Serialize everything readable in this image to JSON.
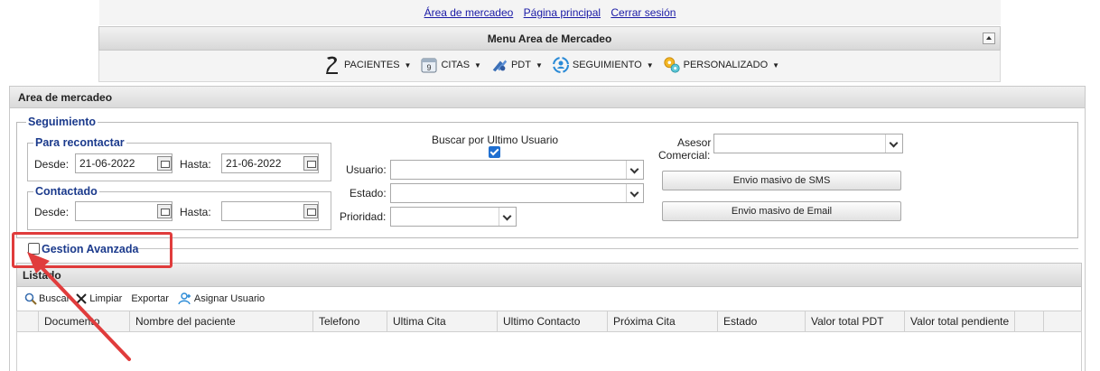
{
  "top_links": [
    "Área de mercadeo",
    "Página principal",
    "Cerrar sesión"
  ],
  "menu": {
    "title": "Menu Area de Mercadeo",
    "items": [
      {
        "label": "PACIENTES",
        "icon": "patient-icon"
      },
      {
        "label": "CITAS",
        "icon": "calendar-icon"
      },
      {
        "label": "PDT",
        "icon": "tooth-tools-icon"
      },
      {
        "label": "SEGUIMIENTO",
        "icon": "followup-icon"
      },
      {
        "label": "PERSONALIZADO",
        "icon": "gears-icon"
      }
    ]
  },
  "panel": {
    "title": "Area de mercadeo",
    "seguimiento": {
      "legend": "Seguimiento",
      "recontactar": {
        "legend": "Para recontactar",
        "desde_label": "Desde:",
        "desde_value": "21-06-2022",
        "hasta_label": "Hasta:",
        "hasta_value": "21-06-2022"
      },
      "contactado": {
        "legend": "Contactado",
        "desde_label": "Desde:",
        "desde_value": "",
        "hasta_label": "Hasta:",
        "hasta_value": ""
      },
      "buscar_ultimo_usuario_label": "Buscar por Ultimo Usuario",
      "buscar_ultimo_usuario_checked": true,
      "usuario_label": "Usuario:",
      "estado_label": "Estado:",
      "prioridad_label": "Prioridad:",
      "asesor_label_1": "Asesor",
      "asesor_label_2": "Comercial:",
      "sms_button": "Envio masivo de SMS",
      "email_button": "Envio masivo de Email"
    },
    "gestion_avanzada": {
      "label": "Gestion Avanzada",
      "checked": false
    }
  },
  "listado": {
    "title": "Listado",
    "toolbar": {
      "buscar": "Buscar",
      "limpiar": "Limpiar",
      "exportar": "Exportar",
      "asignar": "Asignar Usuario"
    },
    "columns": [
      "Documento",
      "Nombre del paciente",
      "Telefono",
      "Ultima Cita",
      "Ultimo Contacto",
      "Próxima Cita",
      "Estado",
      "Valor total PDT",
      "Valor total pendiente"
    ]
  },
  "colors": {
    "accent": "#1f6fd1",
    "annotation": "#e03c3c",
    "legend": "#1b3a8c"
  }
}
